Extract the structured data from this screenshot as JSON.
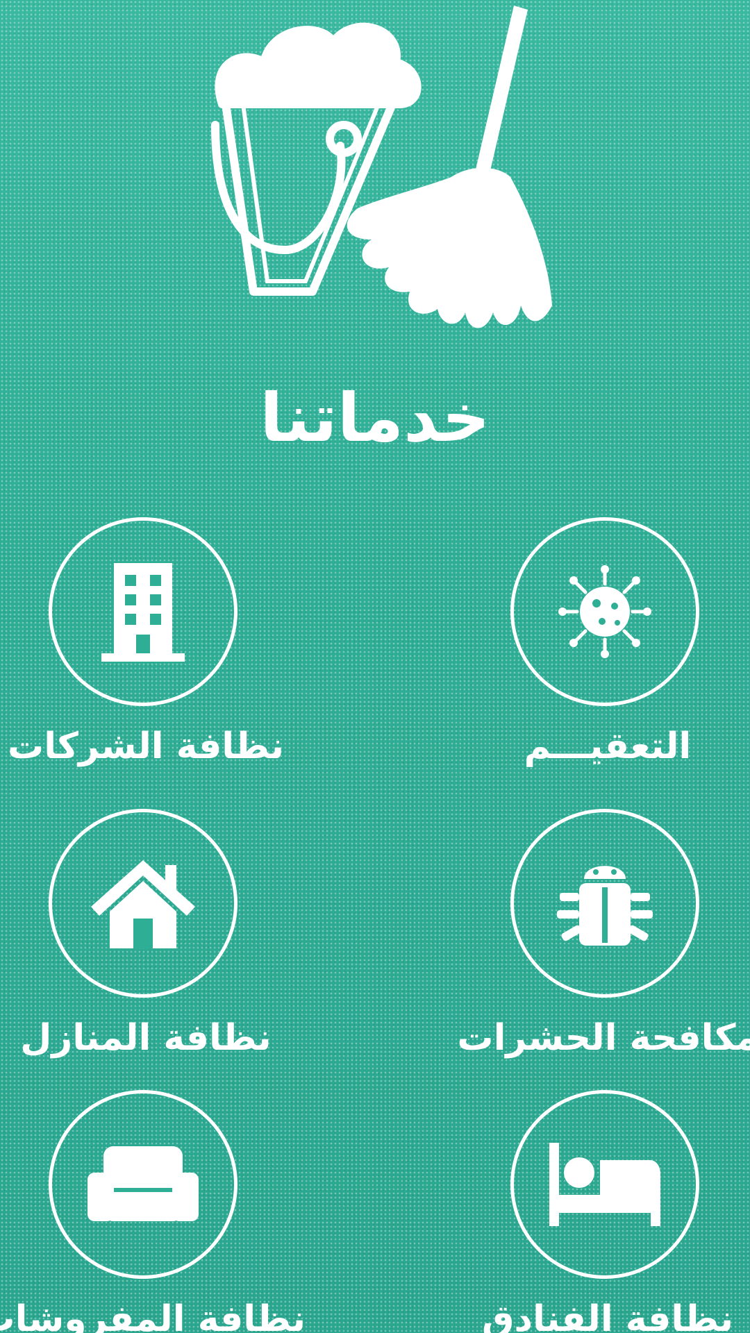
{
  "header": {
    "title": "خدماتنا",
    "logo_icon": "bucket-broom-icon"
  },
  "services": [
    {
      "label": "التعقيـــم",
      "icon": "virus-icon"
    },
    {
      "label": "نظافة الشركات",
      "icon": "office-building-icon"
    },
    {
      "label": "مكافحة الحشرات",
      "icon": "bug-icon"
    },
    {
      "label": "نظافة المنازل",
      "icon": "house-icon"
    },
    {
      "label": "نظافة الفنادق",
      "icon": "bed-icon"
    },
    {
      "label": "نظافة المفروشات",
      "icon": "sofa-icon"
    }
  ],
  "colors": {
    "background": "#2fae96",
    "foreground": "#ffffff"
  }
}
